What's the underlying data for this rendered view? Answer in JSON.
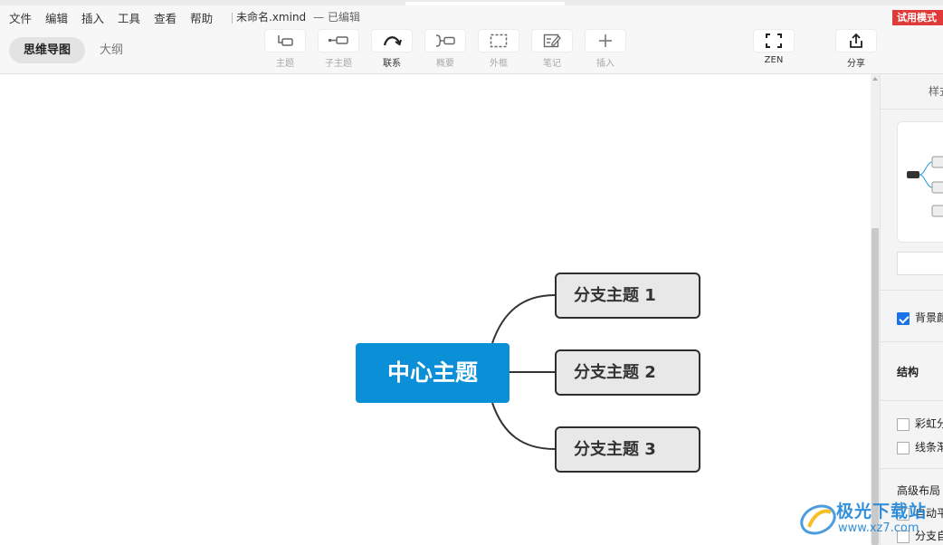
{
  "menubar": {
    "items": [
      "文件",
      "编辑",
      "插入",
      "工具",
      "查看",
      "帮助"
    ],
    "doc_name": "未命名.xmind",
    "doc_status": "— 已编辑",
    "trial_badge": "试用模式"
  },
  "toolbar": {
    "view_tabs": [
      "思维导图",
      "大纲"
    ],
    "tools": [
      {
        "label": "主题",
        "icon": "topic-icon",
        "enabled": false
      },
      {
        "label": "子主题",
        "icon": "subtopic-icon",
        "enabled": false
      },
      {
        "label": "联系",
        "icon": "relationship-icon",
        "enabled": true
      },
      {
        "label": "概要",
        "icon": "summary-icon",
        "enabled": false
      },
      {
        "label": "外框",
        "icon": "boundary-icon",
        "enabled": false
      },
      {
        "label": "笔记",
        "icon": "note-icon",
        "enabled": false
      },
      {
        "label": "插入",
        "icon": "plus-icon",
        "enabled": false
      }
    ],
    "zen_label": "ZEN",
    "share_label": "分享"
  },
  "mindmap": {
    "central_topic": "中心主题",
    "branches": [
      "分支主题 1",
      "分支主题 2",
      "分支主题 3"
    ],
    "central_color": "#0b8fd6"
  },
  "panel": {
    "title": "样式",
    "background_label": "背景颜色",
    "structure_label": "结构",
    "rainbow_label": "彩虹分支",
    "line_label": "线条渐细",
    "advanced_label": "高级布局",
    "auto_label": "自动平衡布局",
    "branch_label": "分支自由布局"
  },
  "watermark": {
    "text": "极光下载站",
    "url": "www.xz7.com"
  }
}
